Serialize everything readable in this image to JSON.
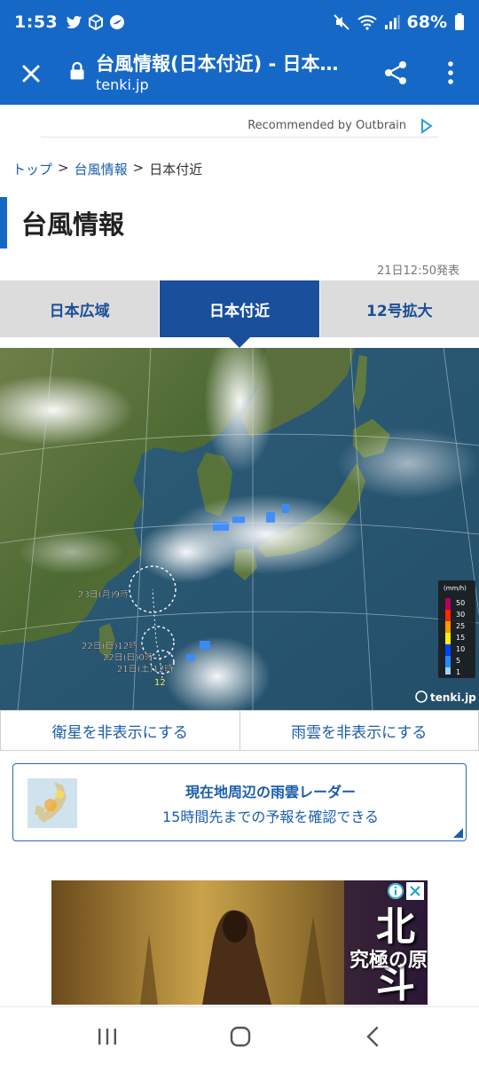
{
  "status_bar": {
    "time": "1:53",
    "battery": "68%",
    "icons": [
      "twitter-icon",
      "cube-icon",
      "circle-app-icon",
      "mute-icon",
      "wifi-icon",
      "signal-icon",
      "battery-icon"
    ]
  },
  "browser": {
    "title": "台風情報(日本付近) - 日本気…",
    "url": "tenki.jp",
    "accent": "#1668c7"
  },
  "outbrain": {
    "label": "Recommended by Outbrain"
  },
  "breadcrumb": {
    "home": "トップ",
    "section": "台風情報",
    "current": "日本付近",
    "separator": ">"
  },
  "page": {
    "heading": "台風情報",
    "issued": "21日12:50発表"
  },
  "tabs": [
    {
      "label": "日本広域",
      "active": false
    },
    {
      "label": "日本付近",
      "active": true
    },
    {
      "label": "12号拡大",
      "active": false
    }
  ],
  "map": {
    "forecast_labels": [
      "23日(月)9時",
      "22日(日)12時",
      "22日(日)0時",
      "21日(土)12時"
    ],
    "storm_number": "12",
    "legend_unit": "(mm/h)",
    "legend_values": [
      "50",
      "30",
      "25",
      "15",
      "10",
      "5",
      "1"
    ],
    "brand": "tenki.jp"
  },
  "toggles": {
    "satellite": "衛星を非表示にする",
    "rain": "雨雲を非表示にする"
  },
  "promo": {
    "title": "現在地周辺の雨雲レーダー",
    "subtitle": "15時間先までの予報を確認できる"
  },
  "ad": {
    "title_big": "北斗の",
    "title_sub": "究極の原"
  }
}
